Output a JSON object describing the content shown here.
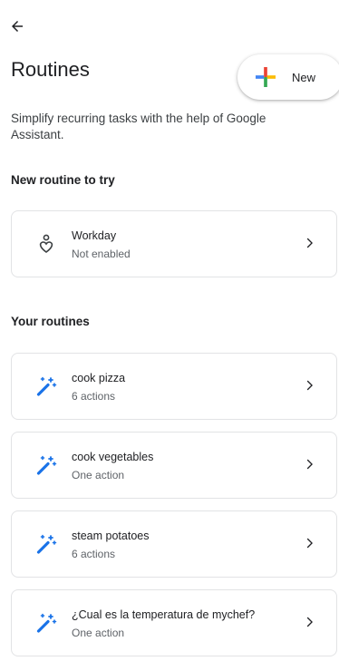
{
  "header": {
    "title": "Routines",
    "new_label": "New"
  },
  "subtitle": "Simplify recurring tasks with the help of Google Assistant.",
  "sections": {
    "try_heading": "New routine to try",
    "yours_heading": "Your routines"
  },
  "try_routines": [
    {
      "name": "Workday",
      "status": "Not enabled",
      "icon": "person-heart-icon"
    }
  ],
  "routines": [
    {
      "name": "cook pizza",
      "actions": "6 actions",
      "icon": "magic-wand-icon"
    },
    {
      "name": "cook vegetables",
      "actions": "One action",
      "icon": "magic-wand-icon"
    },
    {
      "name": "steam potatoes",
      "actions": "6 actions",
      "icon": "magic-wand-icon"
    },
    {
      "name": "¿Cual es la temperatura de mychef?",
      "actions": "One action",
      "icon": "magic-wand-icon"
    }
  ],
  "colors": {
    "google_blue": "#4285F4",
    "google_red": "#EA4335",
    "google_yellow": "#FBBC05",
    "google_green": "#34A853",
    "wand_blue": "#1a73e8"
  }
}
